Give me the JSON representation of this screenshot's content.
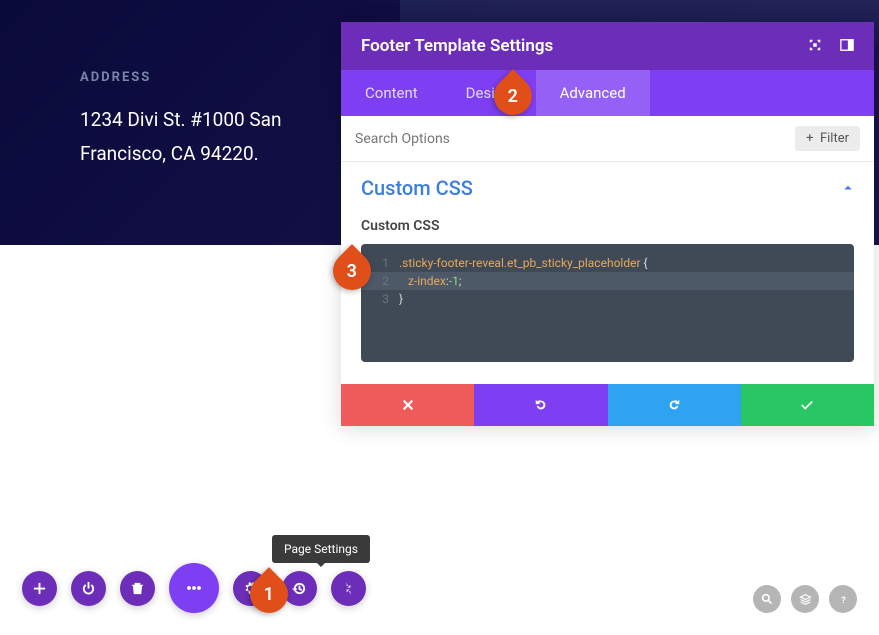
{
  "address": {
    "label": "ADDRESS",
    "line1": "1234 Divi St. #1000 San",
    "line2": "Francisco, CA 94220."
  },
  "panel": {
    "title": "Footer Template Settings",
    "tabs": {
      "content": "Content",
      "design": "Design",
      "advanced": "Advanced"
    },
    "search_placeholder": "Search Options",
    "filter_label": "Filter",
    "section_title": "Custom CSS",
    "field_label": "Custom CSS",
    "code": {
      "line1_selector": ".sticky-footer-reveal.et_pb_sticky_placeholder",
      "line1_brace": "{",
      "line2_prop": "z-index",
      "line2_colon": ":",
      "line2_minus": "-",
      "line2_val": "1",
      "line2_semi": ";",
      "line3_brace": "}",
      "ln1": "1",
      "ln2": "2",
      "ln3": "3"
    }
  },
  "tooltip": "Page Settings",
  "markers": {
    "m1": "1",
    "m2": "2",
    "m3": "3"
  }
}
